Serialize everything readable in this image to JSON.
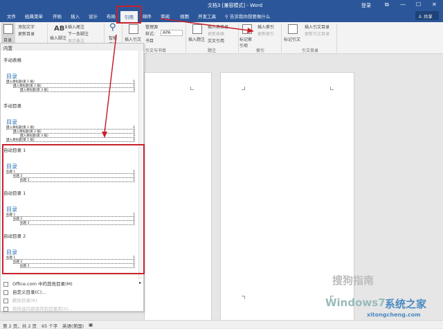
{
  "titlebar": {
    "title": "文档3 [兼容模式] - Word",
    "login": "登录",
    "minimize": "—",
    "restore": "☐",
    "close": "✕",
    "ribbon_display": "⧉"
  },
  "tabs": [
    "文件",
    "经典菜单",
    "开始",
    "插入",
    "设计",
    "布局",
    "引用",
    "邮件",
    "审阅",
    "视图",
    "开发工具"
  ],
  "tell_me": "告诉我你想要做什么",
  "share": "共享",
  "ribbon": {
    "toc": "目录",
    "add_text": "添加文字",
    "update_toc": "更新目录",
    "insert_footnote": "插入脚注",
    "insert_endnote": "插入尾注",
    "next_footnote": "下一条脚注",
    "show_notes": "显示备注",
    "smart_lookup": "智能查找",
    "insert_citation": "插入引文",
    "manage_sources": "管理源",
    "style_label": "样式:",
    "style_value": "APA",
    "bibliography": "书目",
    "group_citations": "引文与书目",
    "insert_caption": "插入题注",
    "insert_table_of_figures": "插入表目录",
    "update_table": "更新表格",
    "cross_reference": "交叉引用",
    "group_captions": "题注",
    "mark_entry": "标记索引项",
    "insert_index": "插入索引",
    "update_index": "更新索引",
    "group_index": "索引",
    "mark_citation": "标记引文",
    "insert_toa": "插入引文目录",
    "update_toa": "更新引文目录",
    "group_toa": "引文目录"
  },
  "menu": {
    "header": "内置",
    "items": [
      {
        "section": "手动表格",
        "title": "目录",
        "lines": [
          [
            "键入章标题(第 1 级)",
            "1"
          ],
          [
            "键入章标题(第 2 级)",
            "2"
          ],
          [
            "键入章标题(第 3 级)",
            "3"
          ]
        ]
      },
      {
        "section": "手动目录",
        "title": "目录",
        "lines": [
          [
            "键入章标题(第 1 级)",
            "1"
          ],
          [
            "键入章标题(第 2 级)",
            "2"
          ],
          [
            "键入章标题(第 3 级)",
            "3"
          ],
          [
            "键入章标题(第 1 级)",
            "4"
          ]
        ]
      },
      {
        "section": "自动目录 1",
        "title": "目录",
        "lines": [
          [
            "标题 1",
            "1"
          ],
          [
            "标题 2",
            "1"
          ],
          [
            "标题 3",
            "1"
          ]
        ]
      },
      {
        "section": "自动目录 1",
        "title": "目录",
        "lines": [
          [
            "标题 1",
            "1"
          ],
          [
            "标题 2",
            "1"
          ],
          [
            "标题 3",
            "1"
          ]
        ]
      },
      {
        "section": "自动目录 2",
        "title": "目录",
        "lines": [
          [
            "标题 1",
            "1"
          ],
          [
            "标题 2",
            "1"
          ],
          [
            "标题 3",
            "1"
          ]
        ]
      }
    ],
    "more": "Office.com 中的其他目录(M)",
    "custom": "自定义目录(C)...",
    "remove": "删除目录(R)",
    "save": "将所选内容保存到目录库(S)..."
  },
  "status": {
    "pages": "第 2 页，共 2 页",
    "words": "65 个字",
    "lang": "英语(美国)"
  },
  "watermarks": [
    "搜狗指南",
    "Windows7",
    "系统之家",
    "xitongcheng.com"
  ]
}
